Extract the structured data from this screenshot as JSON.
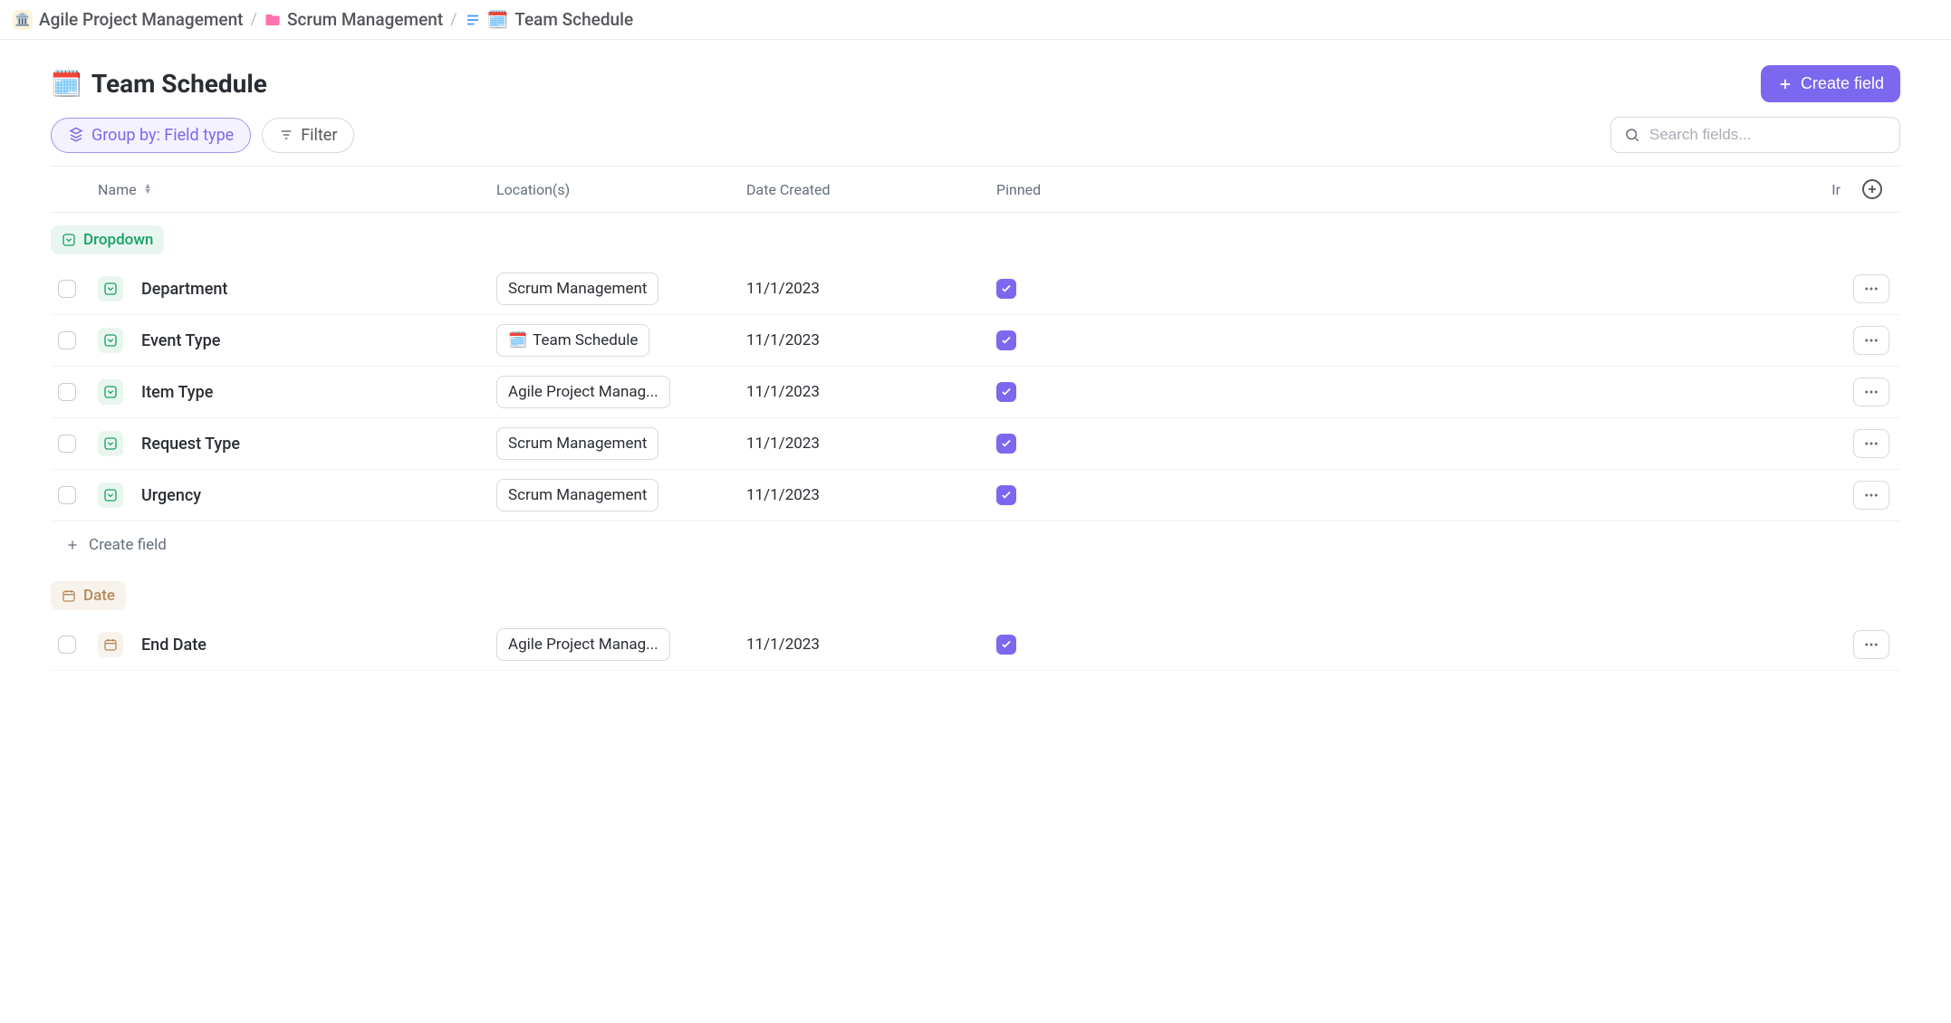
{
  "breadcrumb": [
    {
      "icon": "bank",
      "label": "Agile Project Management"
    },
    {
      "icon": "folder",
      "label": "Scrum Management"
    },
    {
      "icon": "list",
      "emoji": "🗓️",
      "label": "Team Schedule"
    }
  ],
  "page": {
    "emoji": "🗓️",
    "title": "Team Schedule"
  },
  "buttons": {
    "create_field": "Create field",
    "group_by": "Group by: Field type",
    "filter": "Filter",
    "create_field_inline": "Create field"
  },
  "search": {
    "placeholder": "Search fields..."
  },
  "table": {
    "columns": {
      "name": "Name",
      "locations": "Location(s)",
      "date_created": "Date Created",
      "pinned": "Pinned",
      "trunc": "Ir"
    },
    "groups": [
      {
        "type": "dropdown",
        "label": "Dropdown",
        "rows": [
          {
            "name": "Department",
            "location": "Scrum Management",
            "loc_emoji": "",
            "date": "11/1/2023",
            "pinned": true
          },
          {
            "name": "Event Type",
            "location": "Team Schedule",
            "loc_emoji": "🗓️",
            "date": "11/1/2023",
            "pinned": true
          },
          {
            "name": "Item Type",
            "location": "Agile Project Manag...",
            "loc_emoji": "",
            "date": "11/1/2023",
            "pinned": true
          },
          {
            "name": "Request Type",
            "location": "Scrum Management",
            "loc_emoji": "",
            "date": "11/1/2023",
            "pinned": true
          },
          {
            "name": "Urgency",
            "location": "Scrum Management",
            "loc_emoji": "",
            "date": "11/1/2023",
            "pinned": true
          }
        ]
      },
      {
        "type": "date",
        "label": "Date",
        "rows": [
          {
            "name": "End Date",
            "location": "Agile Project Manag...",
            "loc_emoji": "",
            "date": "11/1/2023",
            "pinned": true
          }
        ]
      }
    ]
  }
}
